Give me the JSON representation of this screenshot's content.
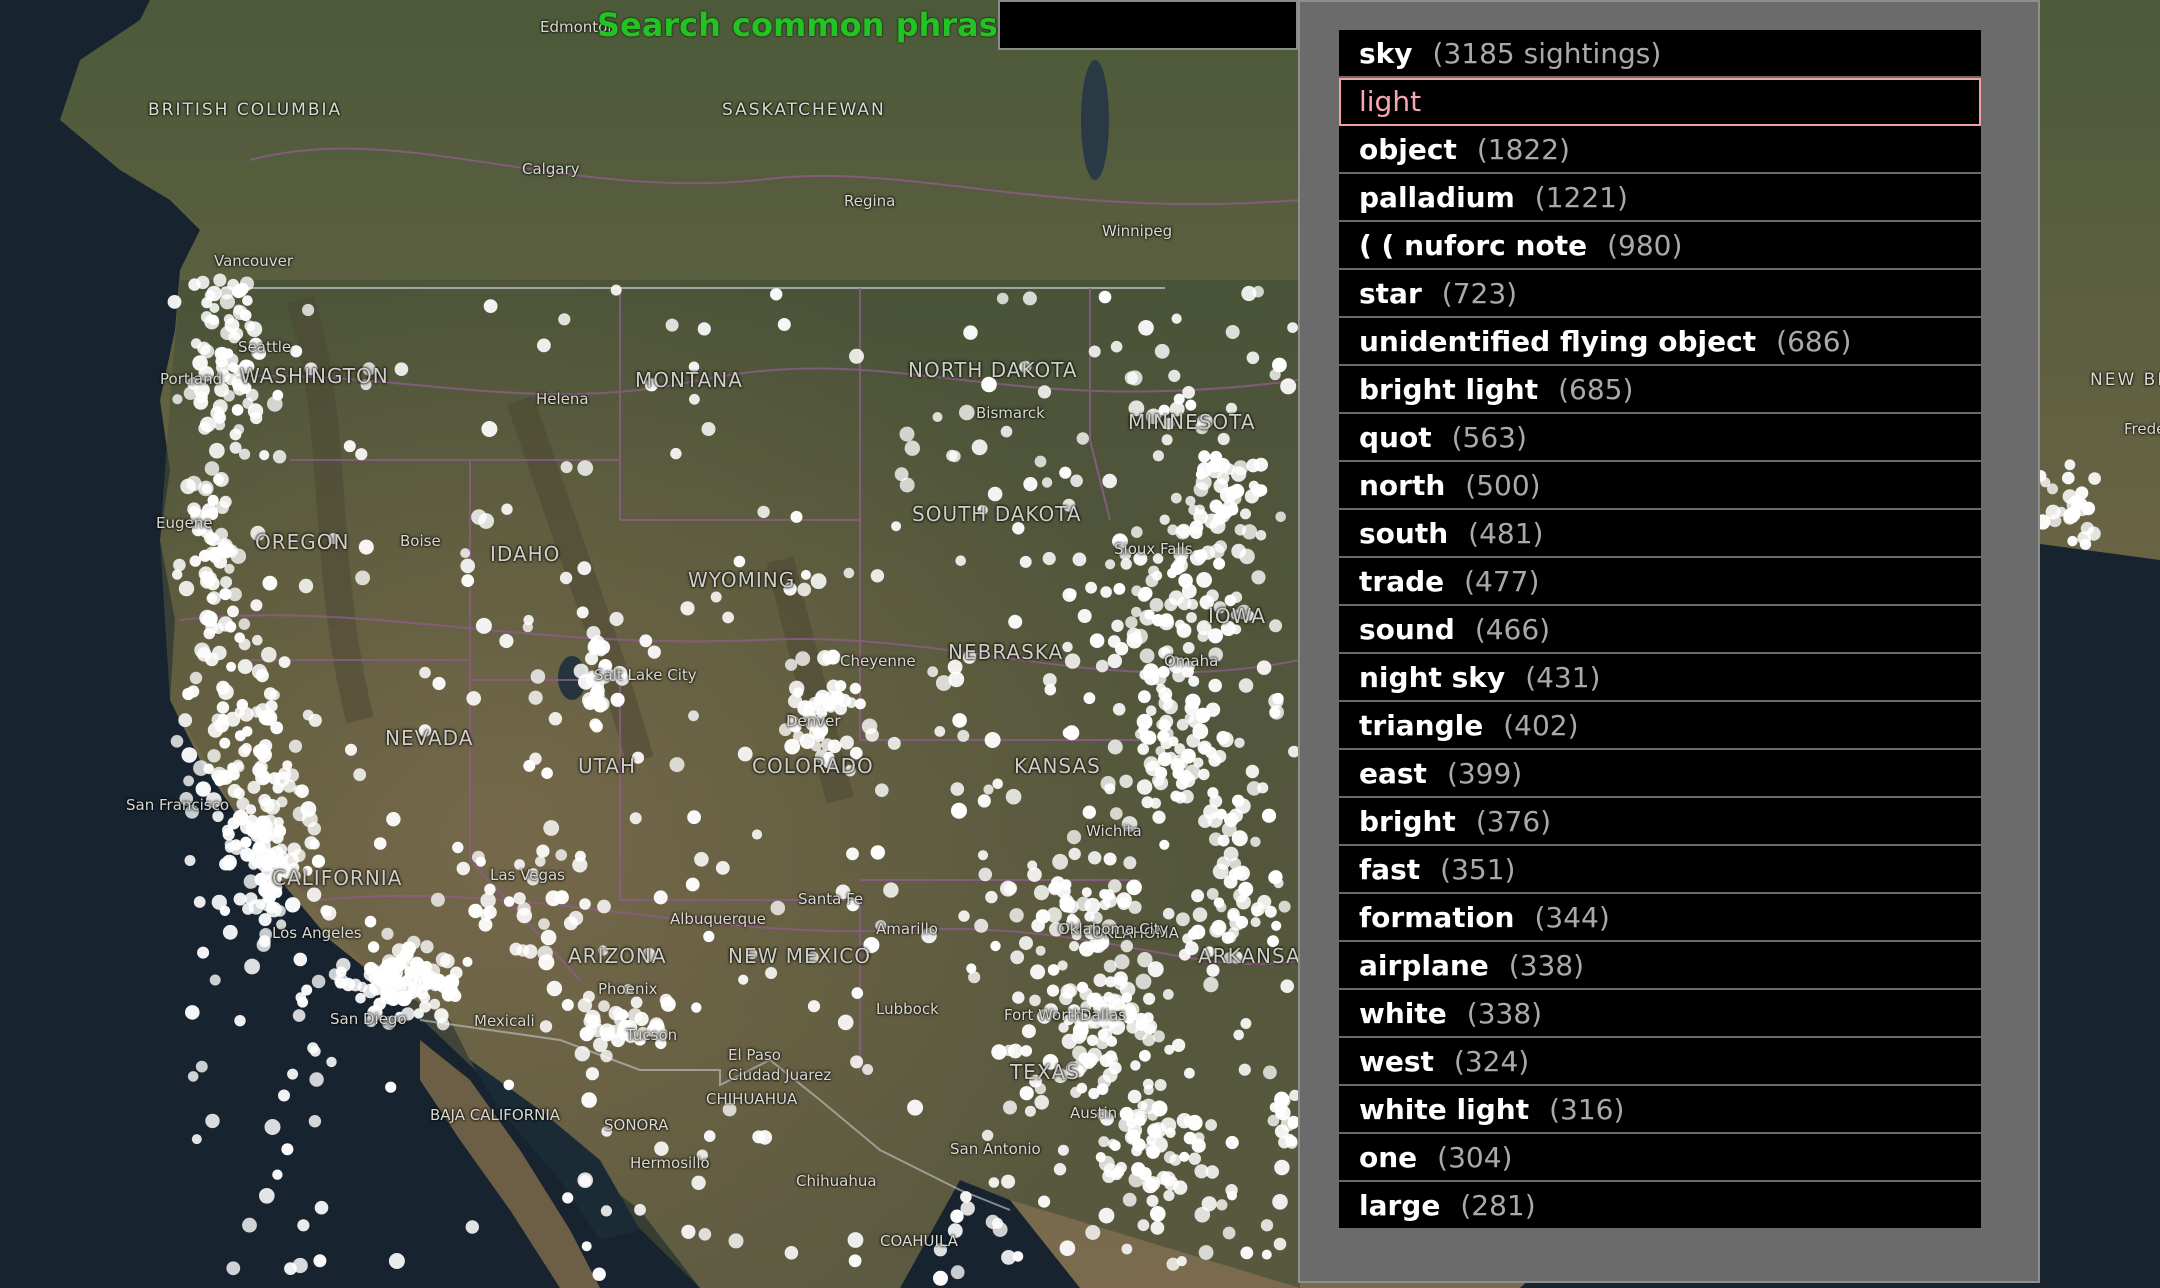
{
  "search": {
    "label": "Search common phrases:",
    "value": ""
  },
  "map": {
    "region_labels": [
      "BRITISH COLUMBIA",
      "SASKATCHEWAN",
      "MONTANA",
      "NORTH DAKOTA",
      "SOUTH DAKOTA",
      "OREGON",
      "IDAHO",
      "WYOMING",
      "NEBRASKA",
      "NEVADA",
      "UTAH",
      "COLORADO",
      "KANSAS",
      "CALIFORNIA",
      "NEW MEXICO",
      "ARIZONA",
      "BAJA CALIFORNIA",
      "SONORA",
      "CHIHUAHUA",
      "COAHUILA",
      "MINNESOTA",
      "IOWA",
      "WASHINGTON",
      "ARKANSAS",
      "OKLAHOMA",
      "TEXAS",
      "NEW BRUNSWICK"
    ],
    "city_labels": [
      "Edmonton",
      "Calgary",
      "Regina",
      "Winnipeg",
      "Vancouver",
      "Seattle",
      "Portland",
      "Eugene",
      "Helena",
      "Boise",
      "Bismarck",
      "Salt Lake City",
      "Cheyenne",
      "Sioux Falls",
      "Omaha",
      "San Francisco",
      "Las Vegas",
      "Los Angeles",
      "San Diego",
      "Mexicali",
      "Phoenix",
      "Tucson",
      "Albuquerque",
      "Santa Fe",
      "Amarillo",
      "Lubbock",
      "El Paso",
      "Ciudad Juarez",
      "Fort Worth",
      "Dallas",
      "Austin",
      "San Antonio",
      "Hermosillo",
      "Chihuahua",
      "Oklahoma City",
      "Wichita",
      "Denver",
      "Fredericton"
    ]
  },
  "suggestions": [
    {
      "phrase": "sky",
      "count": "(3185 sightings)"
    },
    {
      "phrase": "light",
      "count": ""
    },
    {
      "phrase": "object",
      "count": "(1822)"
    },
    {
      "phrase": "palladium",
      "count": "(1221)"
    },
    {
      "phrase": "( ( nuforc note",
      "count": "(980)"
    },
    {
      "phrase": "star",
      "count": "(723)"
    },
    {
      "phrase": "unidentified flying object",
      "count": "(686)"
    },
    {
      "phrase": "bright light",
      "count": "(685)"
    },
    {
      "phrase": "quot",
      "count": "(563)"
    },
    {
      "phrase": "north",
      "count": "(500)"
    },
    {
      "phrase": "south",
      "count": "(481)"
    },
    {
      "phrase": "trade",
      "count": "(477)"
    },
    {
      "phrase": "sound",
      "count": "(466)"
    },
    {
      "phrase": "night sky",
      "count": "(431)"
    },
    {
      "phrase": "triangle",
      "count": "(402)"
    },
    {
      "phrase": "east",
      "count": "(399)"
    },
    {
      "phrase": "bright",
      "count": "(376)"
    },
    {
      "phrase": "fast",
      "count": "(351)"
    },
    {
      "phrase": "formation",
      "count": "(344)"
    },
    {
      "phrase": "airplane",
      "count": "(338)"
    },
    {
      "phrase": "white",
      "count": "(338)"
    },
    {
      "phrase": "west",
      "count": "(324)"
    },
    {
      "phrase": "white light",
      "count": "(316)"
    },
    {
      "phrase": "one",
      "count": "(304)"
    },
    {
      "phrase": "large",
      "count": "(281)"
    }
  ],
  "selected_index": 1,
  "colors": {
    "search_label": "#22c322",
    "panel_bg": "#6b6b6b",
    "item_bg": "#000000",
    "selected_text": "#f6a6ae",
    "sighting_dot": "#ffffff"
  }
}
